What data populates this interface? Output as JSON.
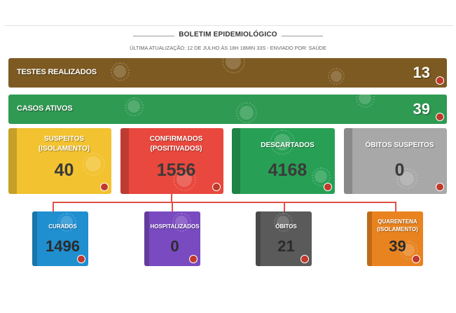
{
  "header": {
    "title": "BOLETIM EPIDEMIOLÓGICO",
    "subtitle": "ÚLTIMA ATUALIZAÇÃO: 12 DE JULHO ÀS 18H 18MIN 33S - ENVIADO POR: SAÚDE"
  },
  "summary": {
    "tests": {
      "label": "TESTES REALIZADOS",
      "value": "13"
    },
    "active": {
      "label": "CASOS ATIVOS",
      "value": "39"
    }
  },
  "cards": {
    "suspects": {
      "line1": "SUSPEITOS",
      "line2": "(ISOLAMENTO)",
      "value": "40"
    },
    "confirmed": {
      "line1": "CONFIRMADOS",
      "line2": "(POSITIVADOS)",
      "value": "1556"
    },
    "discarded": {
      "line1": "DESCARTADOS",
      "value": "4168"
    },
    "suspect_deaths": {
      "line1": "ÓBITOS SUSPEITOS",
      "value": "0"
    }
  },
  "breakdown": {
    "cured": {
      "label": "CURADOS",
      "value": "1496"
    },
    "hospitalized": {
      "label": "HOSPITALIZADOS",
      "value": "0"
    },
    "deaths": {
      "label": "ÓBITOS",
      "value": "21"
    },
    "quarantine": {
      "line1": "QUARENTENA",
      "line2": "(ISOLAMENTO)",
      "value": "39"
    }
  },
  "colors": {
    "tests": "#7d5a22",
    "active": "#2f9a52",
    "suspects": "#f2c230",
    "confirmed": "#e8483d",
    "discarded": "#27a055",
    "suspect_deaths": "#a8a8a8",
    "cured": "#1f8fd0",
    "hospitalized": "#7a4ac0",
    "deaths": "#5a5a5a",
    "quarantine": "#e8831f",
    "connector": "#e05046",
    "badge": "#c0392b"
  },
  "icons": [
    "virus-pattern",
    "info-badge-icon"
  ]
}
